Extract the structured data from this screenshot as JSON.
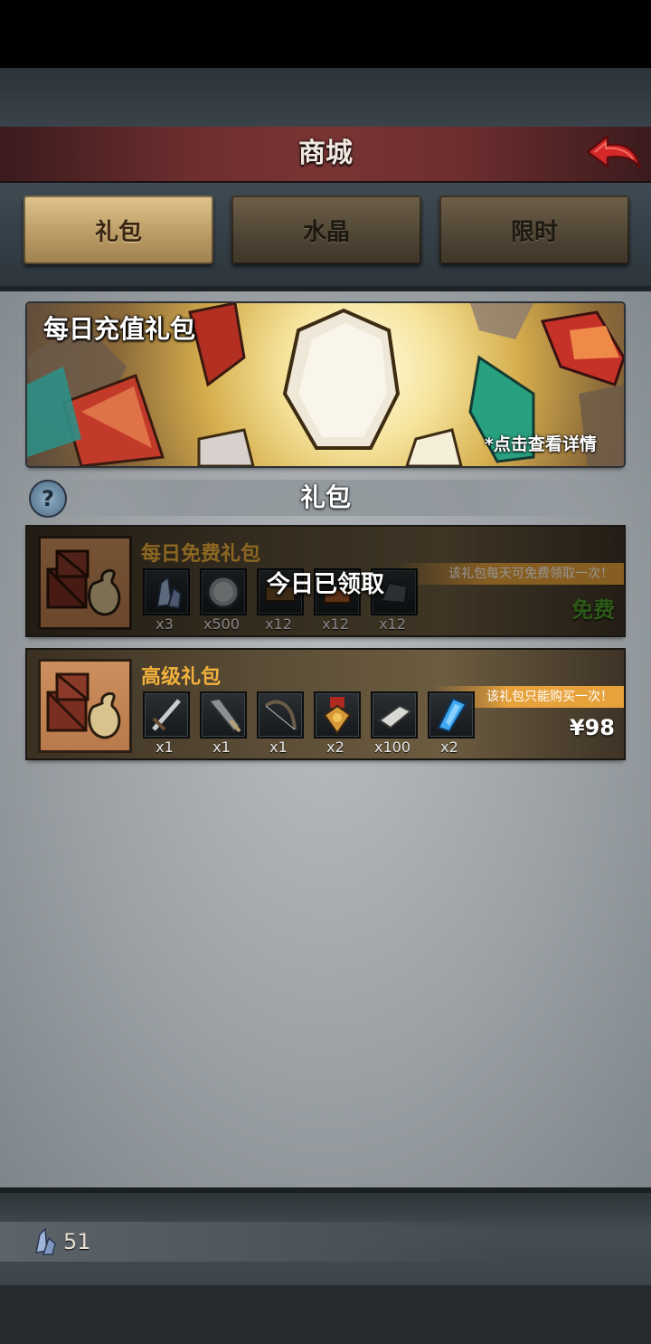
{
  "header": {
    "title": "商城"
  },
  "tabs": [
    {
      "label": "礼包",
      "active": true
    },
    {
      "label": "水晶",
      "active": false
    },
    {
      "label": "限时",
      "active": false
    }
  ],
  "banner": {
    "title": "每日充值礼包",
    "details_label": "*点击查看详情"
  },
  "section": {
    "help_symbol": "?",
    "title": "礼包"
  },
  "packs": [
    {
      "title": "每日免费礼包",
      "note": "该礼包每天可免费领取一次！",
      "status_overlay": "今日已领取",
      "price": "免费",
      "items": [
        {
          "icon": "crystal-cluster-icon",
          "qty": "x3"
        },
        {
          "icon": "silver-coin-icon",
          "qty": "x500"
        },
        {
          "icon": "wood-material-icon",
          "qty": "x12"
        },
        {
          "icon": "leather-material-icon",
          "qty": "x12"
        },
        {
          "icon": "iron-ore-icon",
          "qty": "x12"
        }
      ]
    },
    {
      "title": "高级礼包",
      "note": "该礼包只能购买一次！",
      "price": "¥98",
      "items": [
        {
          "icon": "sword-icon",
          "qty": "x1"
        },
        {
          "icon": "greatsword-icon",
          "qty": "x1"
        },
        {
          "icon": "bow-icon",
          "qty": "x1"
        },
        {
          "icon": "medal-icon",
          "qty": "x2"
        },
        {
          "icon": "metal-bar-icon",
          "qty": "x100"
        },
        {
          "icon": "blue-crystal-icon",
          "qty": "x2"
        }
      ]
    }
  ],
  "footer": {
    "currency_icon": "crystal-icon",
    "currency_amount": "51"
  },
  "colors": {
    "accent_gold": "#f2b13c",
    "free_green": "#4f9a2c",
    "note_orange": "#e8a23b",
    "title_bar_red": "#7a3434"
  }
}
